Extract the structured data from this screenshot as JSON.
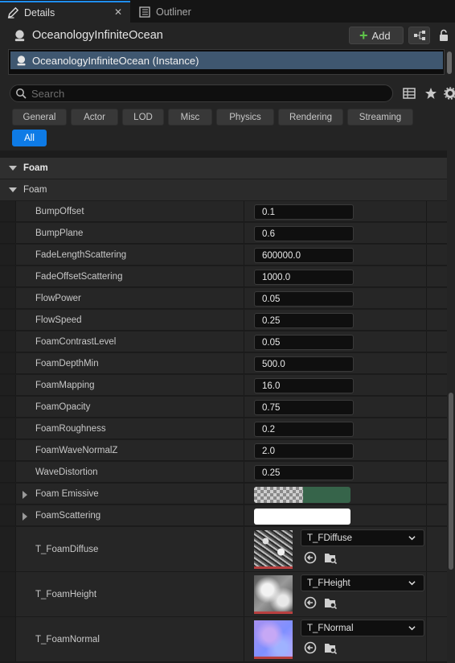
{
  "tabs": [
    {
      "label": "Details",
      "icon": "pencil-icon",
      "active": true
    },
    {
      "label": "Outliner",
      "icon": "outliner-icon",
      "active": false
    }
  ],
  "actor": {
    "title": "OceanologyInfiniteOcean",
    "add_label": "Add",
    "instance_label": "OceanologyInfiniteOcean (Instance)"
  },
  "search": {
    "placeholder": "Search"
  },
  "filters": [
    "General",
    "Actor",
    "LOD",
    "Misc",
    "Physics",
    "Rendering",
    "Streaming",
    "All"
  ],
  "categories": {
    "main": "Foam",
    "sub": "Foam"
  },
  "properties": [
    {
      "name": "BumpOffset",
      "value": "0.1"
    },
    {
      "name": "BumpPlane",
      "value": "0.6"
    },
    {
      "name": "FadeLengthScattering",
      "value": "600000.0"
    },
    {
      "name": "FadeOffsetScattering",
      "value": "1000.0"
    },
    {
      "name": "FlowPower",
      "value": "0.05"
    },
    {
      "name": "FlowSpeed",
      "value": "0.25"
    },
    {
      "name": "FoamContrastLevel",
      "value": "0.05"
    },
    {
      "name": "FoamDepthMin",
      "value": "500.0"
    },
    {
      "name": "FoamMapping",
      "value": "16.0"
    },
    {
      "name": "FoamOpacity",
      "value": "0.75"
    },
    {
      "name": "FoamRoughness",
      "value": "0.2"
    },
    {
      "name": "FoamWaveNormalZ",
      "value": "2.0"
    },
    {
      "name": "WaveDistortion",
      "value": "0.25"
    }
  ],
  "colors": [
    {
      "name": "Foam Emissive",
      "color": "#36644a",
      "has_alpha_checker": true
    },
    {
      "name": "FoamScattering",
      "color": "#ffffff",
      "has_alpha_checker": false
    }
  ],
  "textures": [
    {
      "name": "T_FoamDiffuse",
      "asset": "T_FDiffuse"
    },
    {
      "name": "T_FoamHeight",
      "asset": "T_FHeight"
    },
    {
      "name": "T_FoamNormal",
      "asset": "T_FNormal"
    }
  ]
}
